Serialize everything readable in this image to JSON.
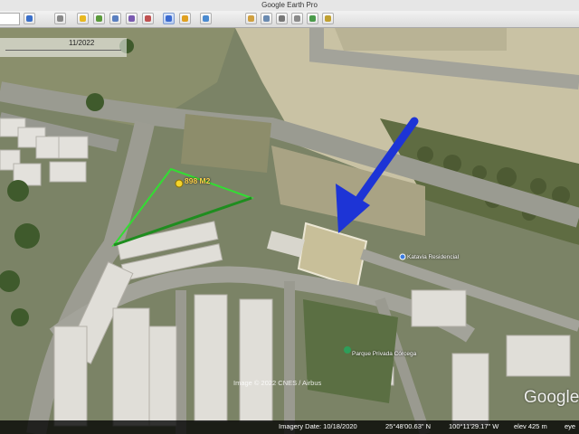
{
  "window": {
    "title": "Google Earth Pro"
  },
  "toolbar": {
    "buttons": [
      {
        "name": "zoom-icon",
        "color": "#3a6fc9"
      },
      {
        "name": "sidebar-toggle-icon",
        "color": "#888888"
      },
      {
        "name": "placemark-icon",
        "color": "#e8b820"
      },
      {
        "name": "polygon-icon",
        "color": "#5a9a3a"
      },
      {
        "name": "path-icon",
        "color": "#5a7fc0"
      },
      {
        "name": "overlay-icon",
        "color": "#7a5ab0"
      },
      {
        "name": "tour-icon",
        "color": "#c05050"
      },
      {
        "name": "historical-imagery-icon",
        "color": "#3b6ad0",
        "active": true
      },
      {
        "name": "sun-icon",
        "color": "#e0a020"
      },
      {
        "name": "planets-icon",
        "color": "#4a8ad0"
      },
      {
        "name": "ruler-icon",
        "color": "#d0a040"
      },
      {
        "name": "email-icon",
        "color": "#6a8ab0"
      },
      {
        "name": "print-icon",
        "color": "#777777"
      },
      {
        "name": "save-image-icon",
        "color": "#8a8a8a"
      },
      {
        "name": "maps-icon",
        "color": "#4a9a4a"
      },
      {
        "name": "upload-icon",
        "color": "#c0a030"
      }
    ]
  },
  "time_slider": {
    "date": "11/2022"
  },
  "map": {
    "area_label": "898 M2",
    "poi_residential": "Katavia Residencial",
    "poi_park": "Parque Privada Córcega",
    "copyright": "Image © 2022 CNES / Airbus",
    "logo": "Google"
  },
  "status": {
    "imagery_date": "Imagery Date: 10/18/2020",
    "lat": "25°48'00.63\" N",
    "lon": "100°11'29.17\" W",
    "elev": "elev  425 m",
    "eye": "eye"
  }
}
